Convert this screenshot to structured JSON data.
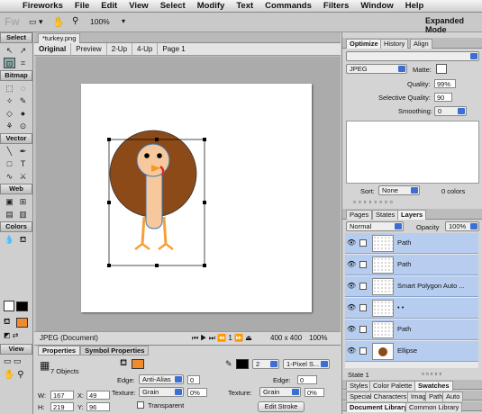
{
  "menubar": {
    "apple": "",
    "app": "Fireworks",
    "items": [
      "File",
      "Edit",
      "View",
      "Select",
      "Modify",
      "Text",
      "Commands",
      "Filters",
      "Window",
      "Help"
    ]
  },
  "toolbar": {
    "logo": "Fw",
    "zoom": "100%",
    "mode": "Expanded Mode"
  },
  "tools": {
    "select_label": "Select",
    "bitmap_label": "Bitmap",
    "vector_label": "Vector",
    "web_label": "Web",
    "colors_label": "Colors",
    "view_label": "View"
  },
  "document": {
    "tab": "*turkey.png",
    "views": [
      "Original",
      "Preview",
      "2-Up",
      "4-Up"
    ],
    "page": "Page 1"
  },
  "status": {
    "format": "JPEG (Document)",
    "frame": "1",
    "size": "400 x 400",
    "zoom": "100%"
  },
  "properties": {
    "tabs": [
      "Properties",
      "Symbol Properties"
    ],
    "summary": "7 Objects",
    "w_label": "W:",
    "w": "167",
    "x_label": "X:",
    "x": "49",
    "h_label": "H:",
    "h": "219",
    "y_label": "Y:",
    "y": "96",
    "edge_label": "Edge:",
    "edge": "Anti-Alias",
    "edge_val": "0",
    "texture_label": "Texture:",
    "texture": "Grain",
    "texture_pct": "0%",
    "transparent": "Transparent",
    "stroke_size": "2",
    "stroke_type": "1-Pixel S...",
    "edge2_label": "Edge:",
    "edge2": "0",
    "texture2_label": "Texture:",
    "texture2": "Grain",
    "texture2_pct": "0%",
    "edit_stroke": "Edit Stroke"
  },
  "optimize": {
    "tabs": [
      "Optimize",
      "History",
      "Align"
    ],
    "format": "JPEG",
    "matte_label": "Matte:",
    "quality_label": "Quality:",
    "quality": "99%",
    "sel_quality_label": "Selective Quality:",
    "sel_quality": "90",
    "smoothing_label": "Smoothing:",
    "smoothing": "0",
    "sort_label": "Sort:",
    "sort": "None",
    "colors": "0 colors"
  },
  "layers": {
    "tabs": [
      "Pages",
      "States",
      "Layers"
    ],
    "blend": "Normal",
    "opacity_label": "Opacity",
    "opacity": "100%",
    "items": [
      "Path",
      "Path",
      "Smart Polygon Auto ...",
      "• •",
      "Path",
      "Ellipse"
    ],
    "state": "State 1"
  },
  "bottom_tabs": {
    "row1": [
      "Styles",
      "Color Palette",
      "Swatches"
    ],
    "row2": [
      "Special Characters",
      "Imag",
      "Path",
      "Auto"
    ],
    "row3": [
      "Document Library",
      "Common Library"
    ]
  }
}
